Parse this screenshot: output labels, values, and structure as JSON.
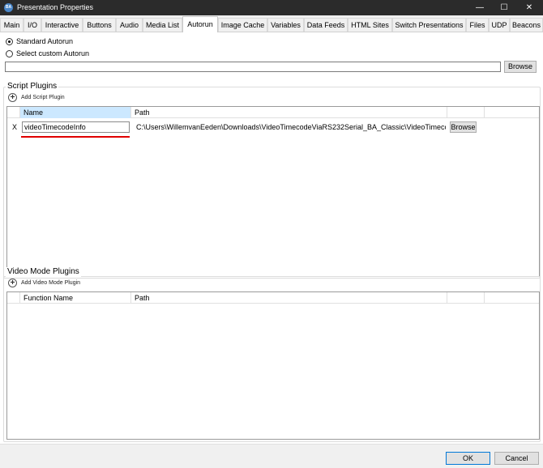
{
  "window": {
    "title": "Presentation Properties",
    "app_icon_text": "BA",
    "minimize_glyph": "—",
    "maximize_glyph": "☐",
    "close_glyph": "✕"
  },
  "tabs": [
    {
      "label": "Main"
    },
    {
      "label": "I/O"
    },
    {
      "label": "Interactive"
    },
    {
      "label": "Buttons"
    },
    {
      "label": "Audio"
    },
    {
      "label": "Media List"
    },
    {
      "label": "Autorun",
      "active": true
    },
    {
      "label": "Image Cache"
    },
    {
      "label": "Variables"
    },
    {
      "label": "Data Feeds"
    },
    {
      "label": "HTML Sites"
    },
    {
      "label": "Switch Presentations"
    },
    {
      "label": "Files"
    },
    {
      "label": "UDP"
    },
    {
      "label": "Beacons"
    }
  ],
  "autorun": {
    "standard_label": "Standard Autorun",
    "standard_checked": true,
    "custom_label": "Select custom Autorun",
    "custom_checked": false,
    "path_value": "",
    "browse_label": "Browse"
  },
  "script_plugins": {
    "legend": "Script Plugins",
    "add_label": "Add Script Plugin",
    "columns": {
      "name": "Name",
      "path": "Path"
    },
    "rows": [
      {
        "delete_label": "X",
        "name": "videoTimecodeInfo",
        "path": "C:\\Users\\WillemvanEeden\\Downloads\\VideoTimecodeViaRS232Serial_BA_Classic\\VideoTimecc",
        "browse_label": "Browse"
      }
    ]
  },
  "video_mode_plugins": {
    "legend": "Video Mode Plugins",
    "add_label": "Add Video Mode Plugin",
    "columns": {
      "function_name": "Function Name",
      "path": "Path"
    }
  },
  "footer": {
    "ok_label": "OK",
    "cancel_label": "Cancel"
  },
  "colors": {
    "titlebar": "#2b2b2b",
    "selected_header": "#cce8ff",
    "annotation_underline": "#e00000",
    "ok_button_border": "#0078d7"
  }
}
